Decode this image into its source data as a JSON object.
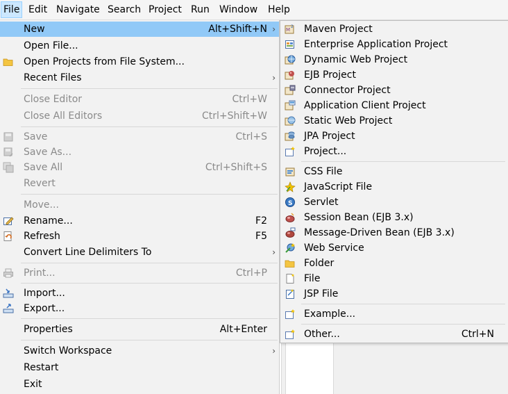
{
  "menubar": {
    "items": [
      "File",
      "Edit",
      "Navigate",
      "Search",
      "Project",
      "Run",
      "Window",
      "Help"
    ]
  },
  "file_menu": {
    "new": {
      "label": "New",
      "accel": "Alt+Shift+N"
    },
    "open_file": "Open File...",
    "open_projects": "Open Projects from File System...",
    "recent_files": "Recent Files",
    "close_editor": {
      "label": "Close Editor",
      "accel": "Ctrl+W"
    },
    "close_all_editors": {
      "label": "Close All Editors",
      "accel": "Ctrl+Shift+W"
    },
    "save": {
      "label": "Save",
      "accel": "Ctrl+S"
    },
    "save_as": "Save As...",
    "save_all": {
      "label": "Save All",
      "accel": "Ctrl+Shift+S"
    },
    "revert": "Revert",
    "move": "Move...",
    "rename": {
      "label": "Rename...",
      "accel": "F2"
    },
    "refresh": {
      "label": "Refresh",
      "accel": "F5"
    },
    "convert_line_delimiters": "Convert Line Delimiters To",
    "print": {
      "label": "Print...",
      "accel": "Ctrl+P"
    },
    "import": "Import...",
    "export": "Export...",
    "properties": {
      "label": "Properties",
      "accel": "Alt+Enter"
    },
    "switch_workspace": "Switch Workspace",
    "restart": "Restart",
    "exit": "Exit"
  },
  "new_submenu": {
    "maven_project": "Maven Project",
    "enterprise_application_project": "Enterprise Application Project",
    "dynamic_web_project": "Dynamic Web Project",
    "ejb_project": "EJB Project",
    "connector_project": "Connector Project",
    "application_client_project": "Application Client Project",
    "static_web_project": "Static Web Project",
    "jpa_project": "JPA Project",
    "project": "Project...",
    "css_file": "CSS File",
    "javascript_file": "JavaScript File",
    "servlet": "Servlet",
    "session_bean": "Session Bean (EJB 3.x)",
    "message_driven_bean": "Message-Driven Bean (EJB 3.x)",
    "web_service": "Web Service",
    "folder": "Folder",
    "file": "File",
    "jsp_file": "JSP File",
    "example": "Example...",
    "other": {
      "label": "Other...",
      "accel": "Ctrl+N"
    }
  },
  "colors": {
    "menu_bg": "#f2f2f2",
    "highlight": "#91c9f7",
    "menubar_active": "#cce8ff",
    "disabled_text": "#8a8a8a"
  },
  "icons": {
    "maven": "m2-project-icon",
    "enterprise": "ear-project-icon",
    "dynamic_web": "web-project-icon",
    "ejb": "ejb-project-icon",
    "connector": "connector-project-icon",
    "app_client": "app-client-icon",
    "static_web": "static-web-icon",
    "jpa": "jpa-icon",
    "project": "new-project-icon",
    "css": "css-file-icon",
    "javascript": "js-file-icon",
    "servlet": "servlet-icon",
    "session_bean": "session-bean-icon",
    "message_bean": "message-bean-icon",
    "web_service": "web-service-icon",
    "folder": "folder-icon",
    "file": "file-icon",
    "jsp": "jsp-file-icon",
    "example": "example-icon",
    "other": "wizard-icon"
  }
}
